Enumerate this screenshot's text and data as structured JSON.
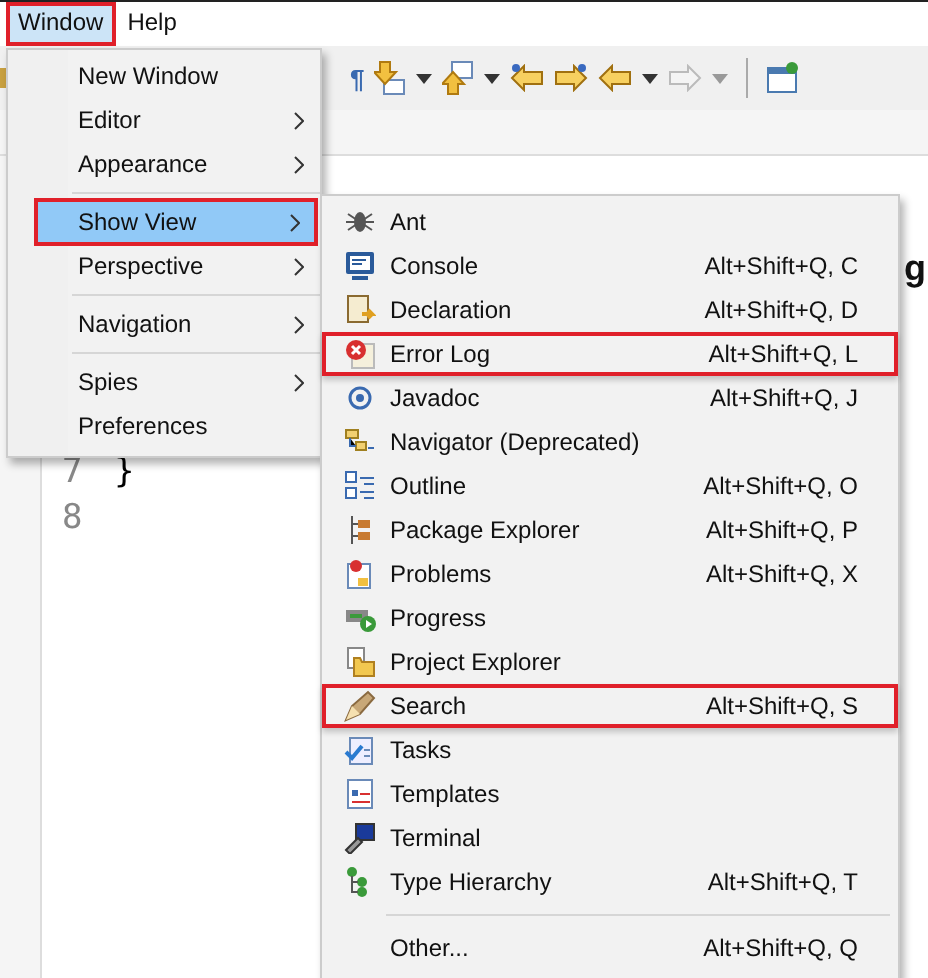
{
  "menubar": [
    {
      "label": "Window",
      "selected": true,
      "highlighted": true
    },
    {
      "label": "Help",
      "selected": false,
      "highlighted": false
    }
  ],
  "toolbar": {
    "glyph": "¶"
  },
  "editor": {
    "line_numbers": [
      "7",
      "8"
    ],
    "lines": [
      "}"
    ],
    "fragment": "g"
  },
  "window_menu": {
    "items": [
      {
        "kind": "item",
        "label": "New Window",
        "submenu": false,
        "selected": false,
        "highlighted": false
      },
      {
        "kind": "item",
        "label": "Editor",
        "submenu": true,
        "selected": false,
        "highlighted": false
      },
      {
        "kind": "item",
        "label": "Appearance",
        "submenu": true,
        "selected": false,
        "highlighted": false
      },
      {
        "kind": "separator"
      },
      {
        "kind": "item",
        "label": "Show View",
        "submenu": true,
        "selected": true,
        "highlighted": true
      },
      {
        "kind": "item",
        "label": "Perspective",
        "submenu": true,
        "selected": false,
        "highlighted": false
      },
      {
        "kind": "separator"
      },
      {
        "kind": "item",
        "label": "Navigation",
        "submenu": true,
        "selected": false,
        "highlighted": false
      },
      {
        "kind": "separator"
      },
      {
        "kind": "item",
        "label": "Spies",
        "submenu": true,
        "selected": false,
        "highlighted": false
      },
      {
        "kind": "item",
        "label": "Preferences",
        "submenu": false,
        "selected": false,
        "highlighted": false
      }
    ]
  },
  "show_view_menu": {
    "items": [
      {
        "kind": "item",
        "label": "Ant",
        "highlighted": false
      },
      {
        "kind": "item",
        "label": "Console",
        "shortcut": "Alt+Shift+Q, C",
        "highlighted": false
      },
      {
        "kind": "item",
        "label": "Declaration",
        "shortcut": "Alt+Shift+Q, D",
        "highlighted": false
      },
      {
        "kind": "item",
        "label": "Error Log",
        "shortcut": "Alt+Shift+Q, L",
        "highlighted": true
      },
      {
        "kind": "item",
        "label": "Javadoc",
        "shortcut": "Alt+Shift+Q, J",
        "highlighted": false
      },
      {
        "kind": "item",
        "label": "Navigator (Deprecated)",
        "highlighted": false
      },
      {
        "kind": "item",
        "label": "Outline",
        "shortcut": "Alt+Shift+Q, O",
        "highlighted": false
      },
      {
        "kind": "item",
        "label": "Package Explorer",
        "shortcut": "Alt+Shift+Q, P",
        "highlighted": false
      },
      {
        "kind": "item",
        "label": "Problems",
        "shortcut": "Alt+Shift+Q, X",
        "highlighted": false
      },
      {
        "kind": "item",
        "label": "Progress",
        "highlighted": false
      },
      {
        "kind": "item",
        "label": "Project Explorer",
        "highlighted": false
      },
      {
        "kind": "item",
        "label": "Search",
        "shortcut": "Alt+Shift+Q, S",
        "highlighted": true
      },
      {
        "kind": "item",
        "label": "Tasks",
        "highlighted": false
      },
      {
        "kind": "item",
        "label": "Templates",
        "highlighted": false
      },
      {
        "kind": "item",
        "label": "Terminal",
        "highlighted": false
      },
      {
        "kind": "item",
        "label": "Type Hierarchy",
        "shortcut": "Alt+Shift+Q, T",
        "highlighted": false
      },
      {
        "kind": "separator"
      },
      {
        "kind": "item",
        "label": "Other...",
        "shortcut": "Alt+Shift+Q, Q",
        "highlighted": false
      }
    ]
  }
}
